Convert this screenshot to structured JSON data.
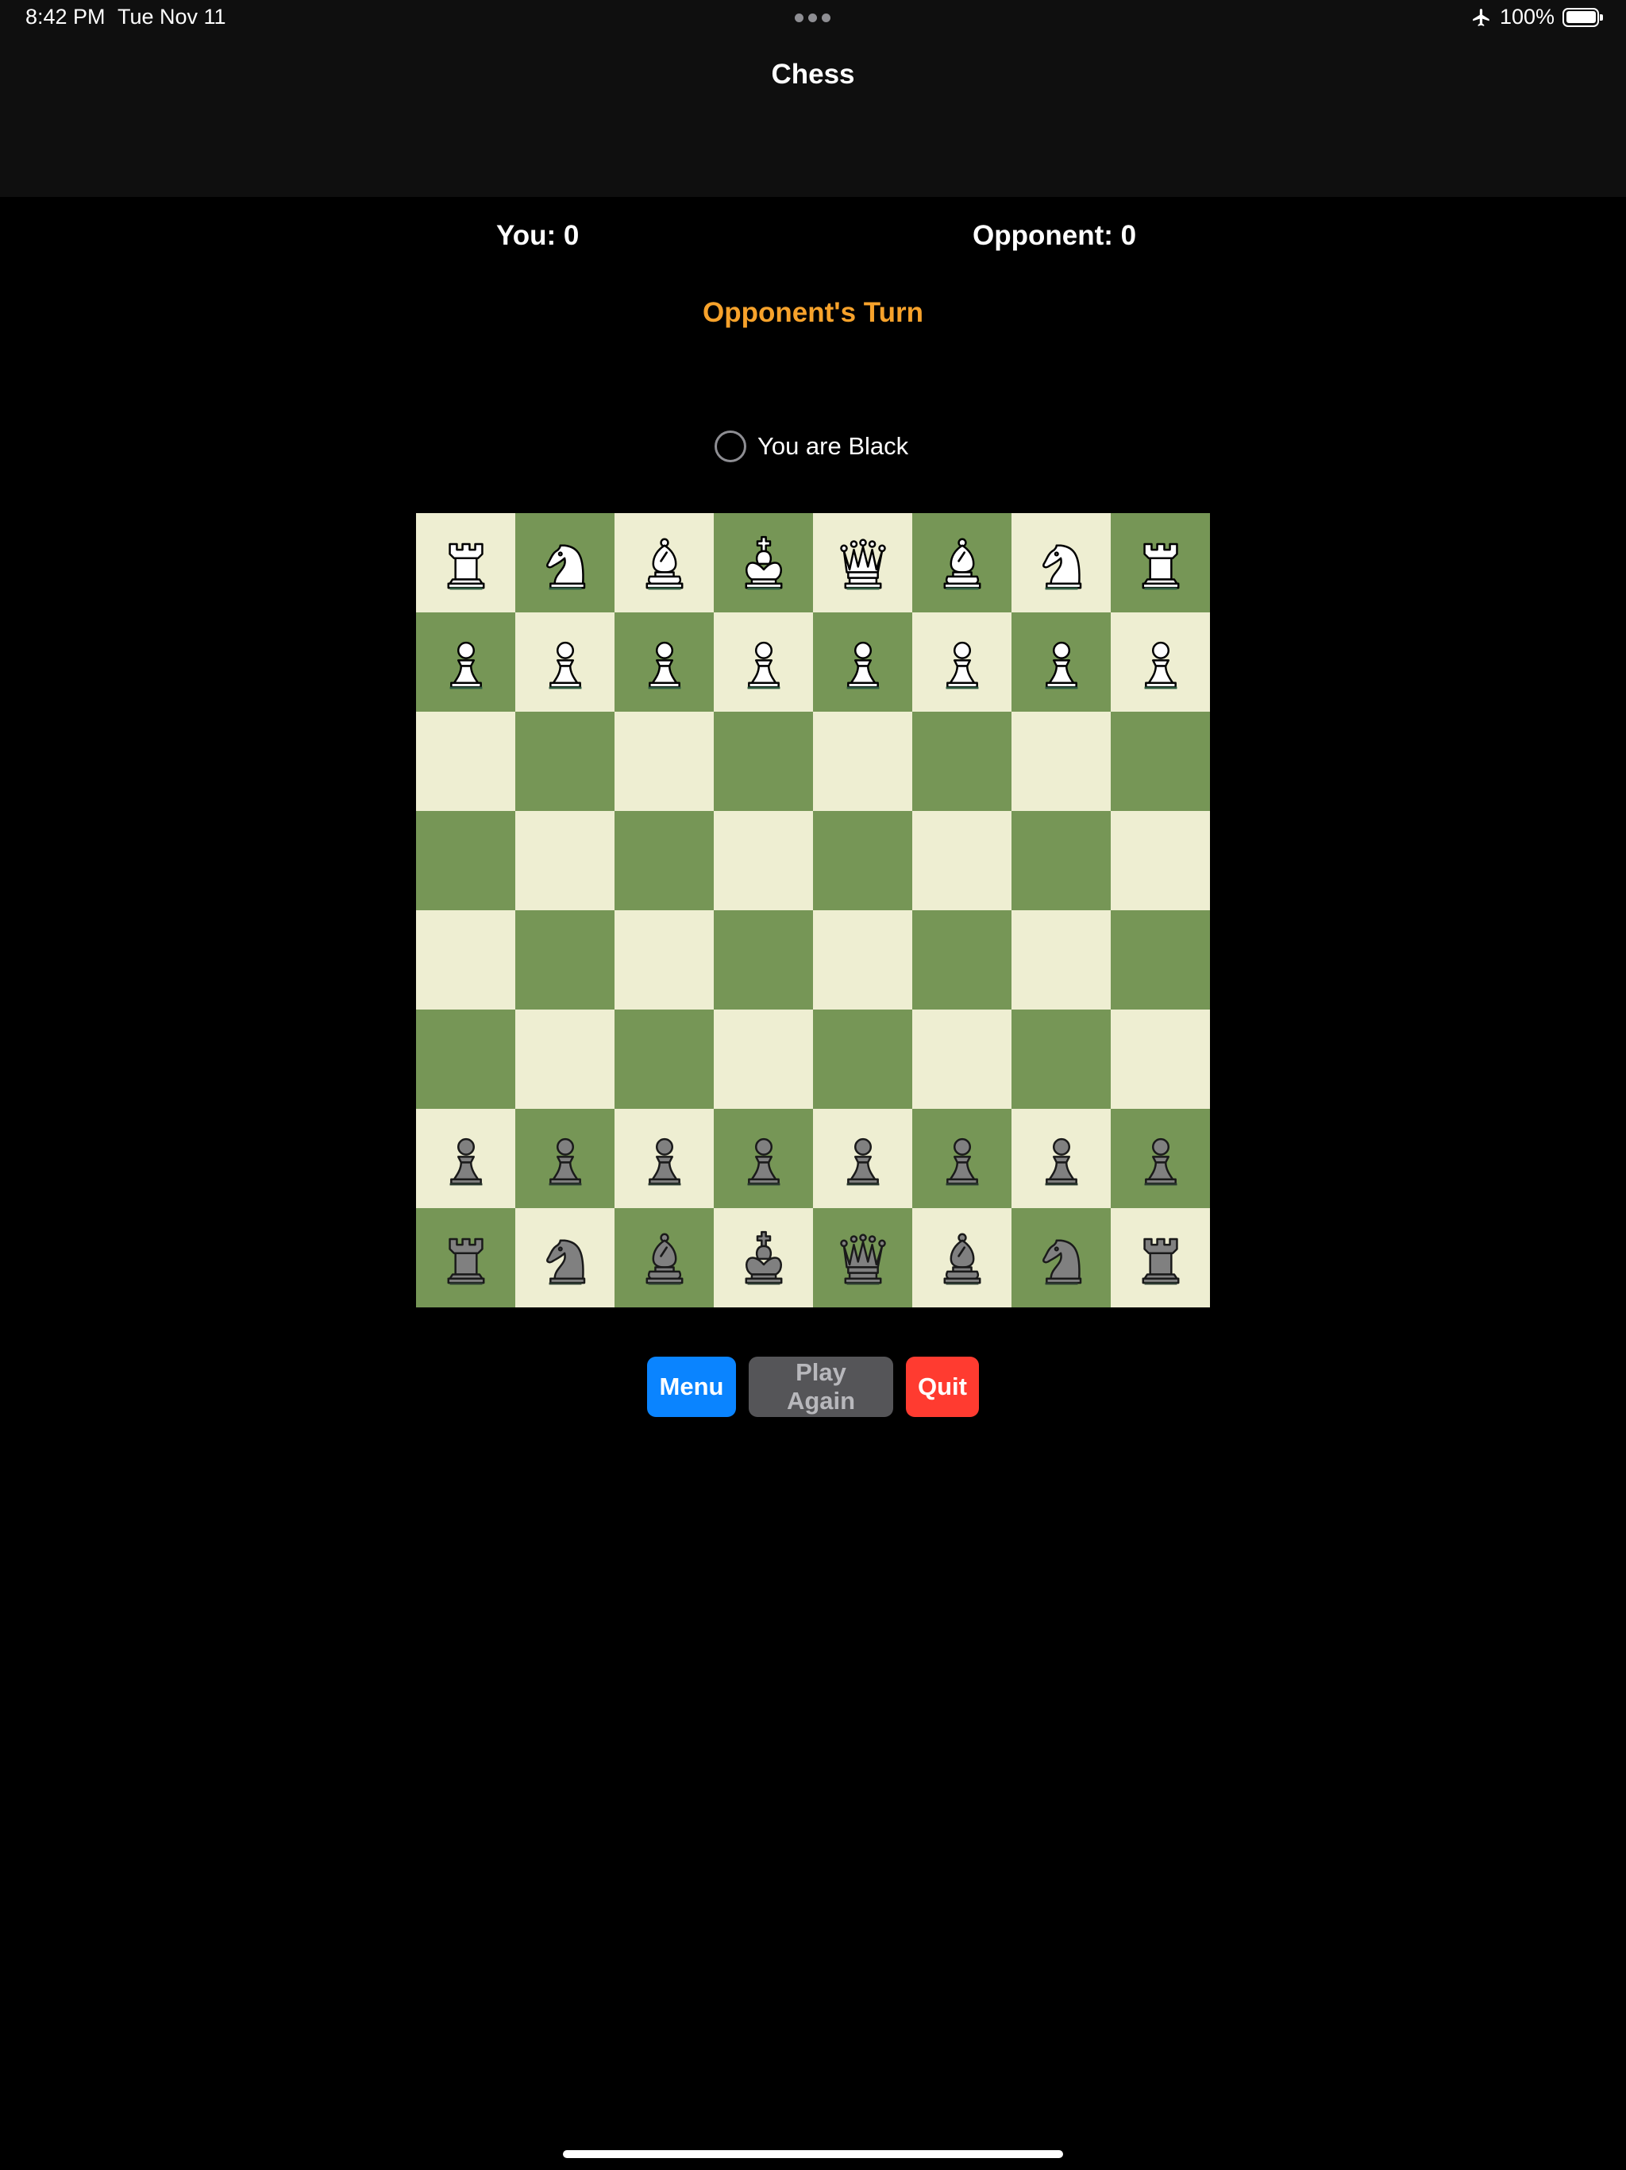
{
  "status_bar": {
    "time": "8:42 PM",
    "date": "Tue Nov 11",
    "battery": "100%",
    "airplane_icon": "airplane-icon",
    "battery_icon": "battery-full-icon"
  },
  "nav": {
    "title": "Chess"
  },
  "scores": {
    "you": "You: 0",
    "opponent": "Opponent: 0"
  },
  "turn": {
    "label": "Opponent's Turn",
    "color": "#f7a22b"
  },
  "player_color": {
    "label": "You are Black"
  },
  "board": {
    "light_color": "#eeeed2",
    "dark_color": "#769656",
    "ranks": [
      [
        "wr",
        "wn",
        "wb",
        "wk",
        "wq",
        "wb",
        "wn",
        "wr"
      ],
      [
        "wp",
        "wp",
        "wp",
        "wp",
        "wp",
        "wp",
        "wp",
        "wp"
      ],
      [
        "",
        "",
        "",
        "",
        "",
        "",
        "",
        ""
      ],
      [
        "",
        "",
        "",
        "",
        "",
        "",
        "",
        ""
      ],
      [
        "",
        "",
        "",
        "",
        "",
        "",
        "",
        ""
      ],
      [
        "",
        "",
        "",
        "",
        "",
        "",
        "",
        ""
      ],
      [
        "bp",
        "bp",
        "bp",
        "bp",
        "bp",
        "bp",
        "bp",
        "bp"
      ],
      [
        "br",
        "bn",
        "bb",
        "bk",
        "bq",
        "bb",
        "bn",
        "br"
      ]
    ]
  },
  "buttons": {
    "menu": "Menu",
    "play_again": "Play Again",
    "quit": "Quit"
  },
  "colors": {
    "menu_button": "#0a84ff",
    "play_again_button": "#555558",
    "quit_button": "#ff3b30"
  }
}
